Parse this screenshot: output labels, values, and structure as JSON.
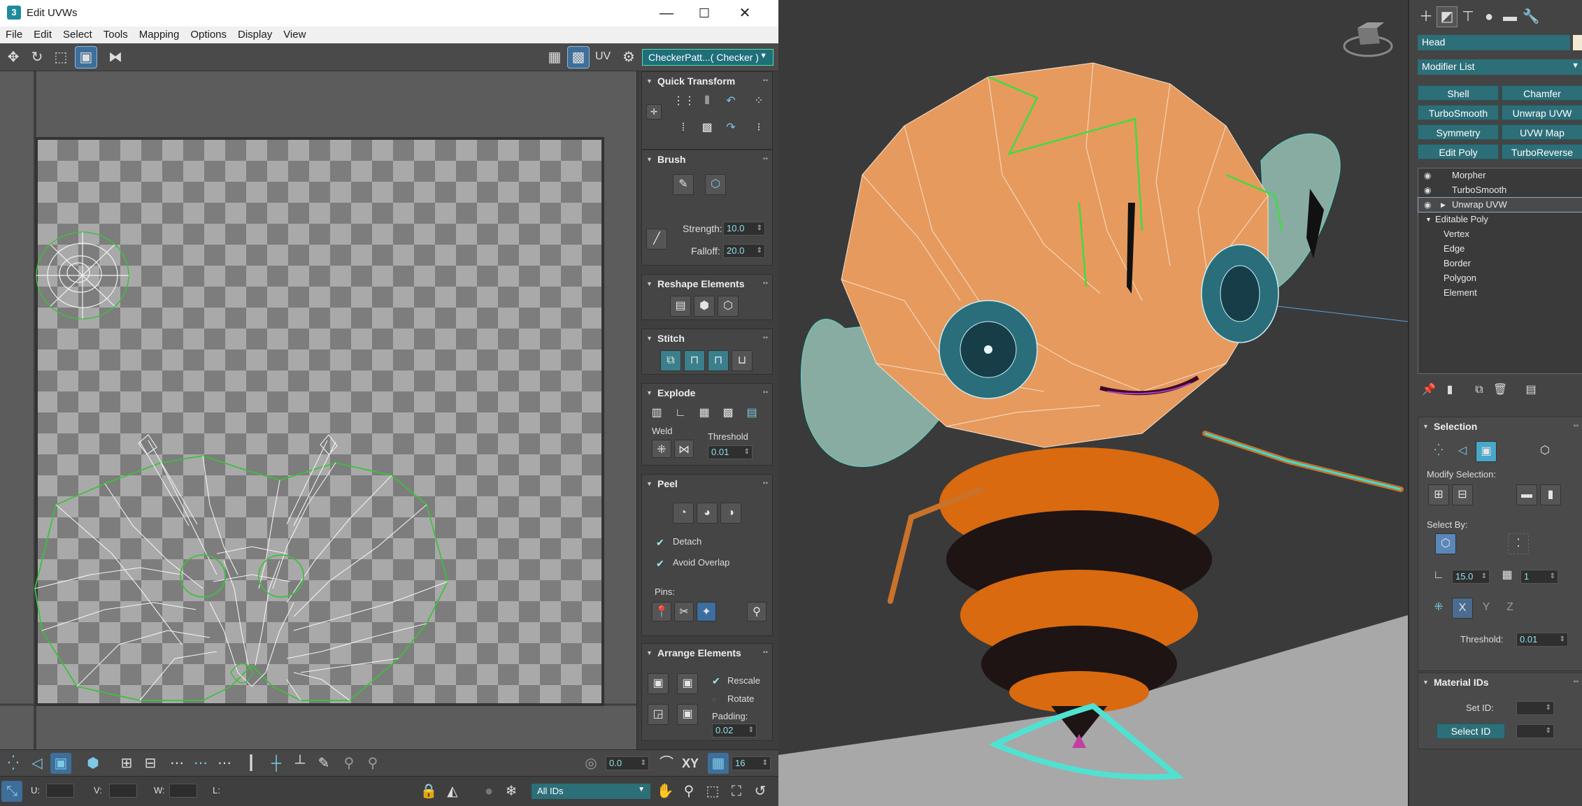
{
  "window": {
    "title": "Edit UVWs",
    "icon_label": "3"
  },
  "menu": [
    "File",
    "Edit",
    "Select",
    "Tools",
    "Mapping",
    "Options",
    "Display",
    "View"
  ],
  "toolbar": {
    "uv_label": "UV",
    "checker_dropdown": "CheckerPatt...( Checker )"
  },
  "rollouts": {
    "quick_transform": "Quick Transform",
    "brush": "Brush",
    "strength_label": "Strength:",
    "strength_value": "10.0",
    "falloff_label": "Falloff:",
    "falloff_value": "20.0",
    "reshape": "Reshape Elements",
    "stitch": "Stitch",
    "explode": "Explode",
    "weld_label": "Weld",
    "threshold_label": "Threshold",
    "threshold_value": "0.01",
    "peel": "Peel",
    "detach_label": "Detach",
    "avoid_overlap_label": "Avoid Overlap",
    "pins_label": "Pins:",
    "arrange": "Arrange Elements",
    "rescale_label": "Rescale",
    "rotate_label": "Rotate",
    "padding_label": "Padding:",
    "padding_value": "0.02"
  },
  "bottom_bar": {
    "angle_value": "0.0",
    "xy_label": "XY",
    "grid_value": "16",
    "u_label": "U:",
    "v_label": "V:",
    "w_label": "W:",
    "l_label": "L:",
    "ids_dropdown": "All IDs"
  },
  "command_panel": {
    "object_name": "Head",
    "object_color": "#f2ead2",
    "modifier_list": "Modifier List",
    "modifier_buttons": [
      "Shell",
      "Chamfer",
      "TurboSmooth",
      "Unwrap UVW",
      "Symmetry",
      "UVW Map",
      "Edit Poly",
      "TurboReverse"
    ],
    "stack": [
      {
        "label": "Morpher"
      },
      {
        "label": "TurboSmooth"
      },
      {
        "label": "Unwrap UVW"
      },
      {
        "label": "Editable Poly"
      },
      {
        "label": "Vertex"
      },
      {
        "label": "Edge"
      },
      {
        "label": "Border"
      },
      {
        "label": "Polygon"
      },
      {
        "label": "Element"
      }
    ],
    "selection_title": "Selection",
    "modify_selection_label": "Modify Selection:",
    "select_by_label": "Select By:",
    "angle_value": "15.0",
    "steps_value": "1",
    "threshold_label": "Threshold:",
    "threshold_value": "0.01",
    "material_ids_title": "Material IDs",
    "set_id_label": "Set ID:",
    "select_id_label": "Select ID"
  },
  "colors": {
    "accent_teal": "#2c6f78",
    "uv_seam_green": "#3fbf3f",
    "bee_orange": "#e8a060"
  }
}
